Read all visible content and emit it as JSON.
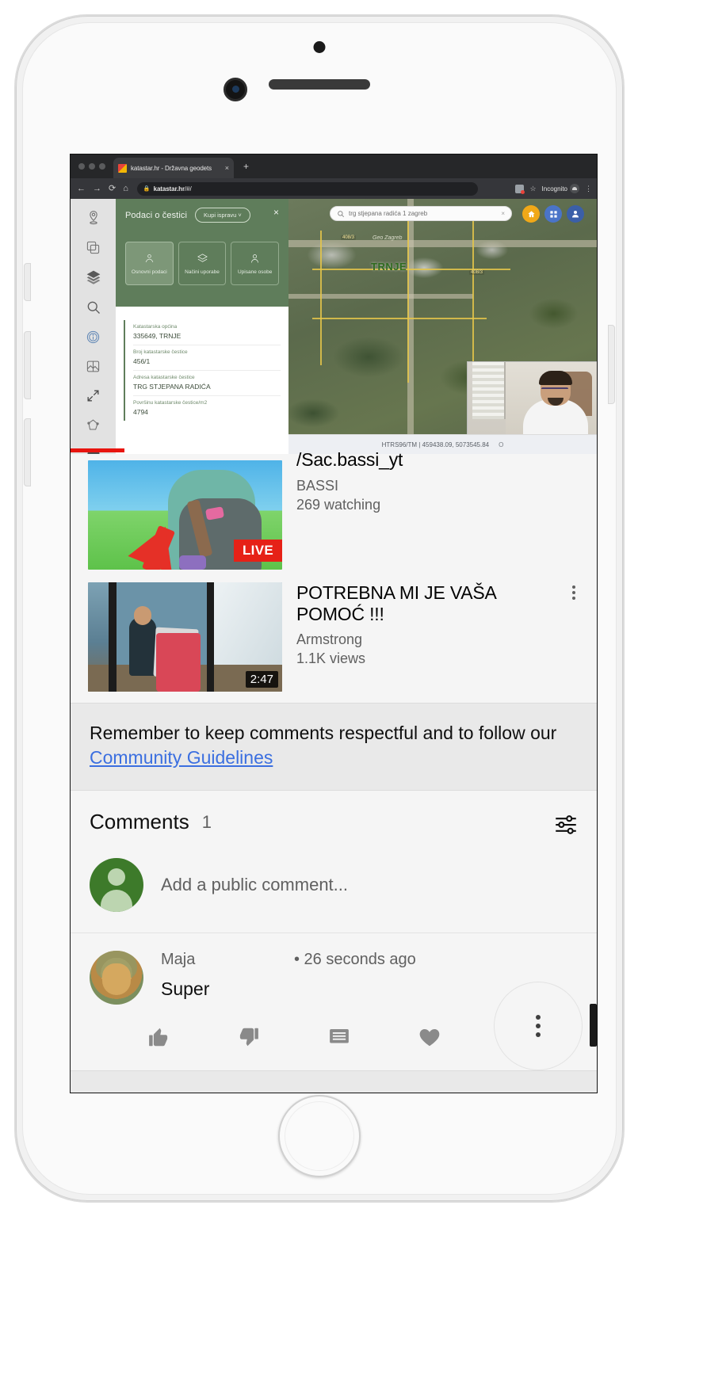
{
  "browser": {
    "tab_title": "katastar.hr - Državna geodets",
    "tab_close": "×",
    "new_tab": "+",
    "back_icon": "←",
    "forward_icon": "→",
    "reload_icon": "⟳",
    "home_icon": "⌂",
    "lock_icon": "🔒",
    "url_domain": "katastar.hr",
    "url_path": "/#/",
    "star_icon": "☆",
    "incognito_label": "Incognito",
    "menu_icon": "⋮"
  },
  "katastar": {
    "panel_title": "Podaci o čestici",
    "buy_button": "Kupi ispravu ˅",
    "close": "×",
    "tabs": [
      {
        "label": "Osnovni podaci",
        "icon": "pin-people-icon",
        "active": true
      },
      {
        "label": "Načini uporabe",
        "icon": "layers-icon",
        "active": false
      },
      {
        "label": "Upisane osobe",
        "icon": "person-icon",
        "active": false
      }
    ],
    "fields": [
      {
        "label": "Katastarska općina",
        "value": "335649, TRNJE"
      },
      {
        "label": "Broj katastarske čestice",
        "value": "456/1"
      },
      {
        "label": "Adresa katastarske čestice",
        "value": "TRG STJEPANA RADIĆA"
      },
      {
        "label": "Površinu katastarske čestice/m2",
        "value": "4794"
      }
    ],
    "toolbar_icons": [
      "location-pin-icon",
      "copy-layers-icon",
      "stacked-layers-icon",
      "search-icon",
      "info-circle-icon",
      "image-compare-icon",
      "fullscreen-arrows-icon",
      "polygon-measure-icon",
      "print-icon"
    ],
    "search_value": "trg stjepana radića 1 zagreb",
    "search_clear": "×",
    "map_place_label": "TRNJE",
    "map_logo_label": "Geo Zagreb",
    "parcel_tags": [
      "408/3",
      "408/3"
    ],
    "coordinate_text": "HTRS96/TM | 459438.09, 5073545.84",
    "coordinate_extra": "O",
    "top_buttons": [
      "home-icon",
      "grid-icon",
      "user-icon"
    ]
  },
  "videos": [
    {
      "title": "/Sac.bassi_yt",
      "channel": "BASSI",
      "meta": "269 watching",
      "badge": "LIVE",
      "badge_type": "live",
      "menu_icon": "kebab-menu-icon"
    },
    {
      "title": "POTREBNA MI JE VAŠA POMOĆ !!!",
      "channel": "Armstrong",
      "meta": "1.1K views",
      "badge": "2:47",
      "badge_type": "duration",
      "menu_icon": "kebab-menu-icon"
    }
  ],
  "guidelines": {
    "text_before": "Remember to keep comments respectful and to follow our ",
    "link_text": "Community Guidelines"
  },
  "comments": {
    "heading": "Comments",
    "count": "1",
    "sort_icon": "sort-filter-icon",
    "add_placeholder": "Add a public comment...",
    "items": [
      {
        "author": "Maja",
        "time": "• 26 seconds ago",
        "text": "Super",
        "actions": [
          "thumbs-up-icon",
          "thumbs-down-icon",
          "reply-icon",
          "heart-icon"
        ]
      }
    ]
  },
  "fab": {
    "icon": "kebab-menu-icon"
  },
  "colors": {
    "accent_red": "#e62117",
    "link_blue": "#3b6fe0",
    "katastar_green": "#5f7d5b",
    "avatar_green": "#3d7a2a"
  }
}
